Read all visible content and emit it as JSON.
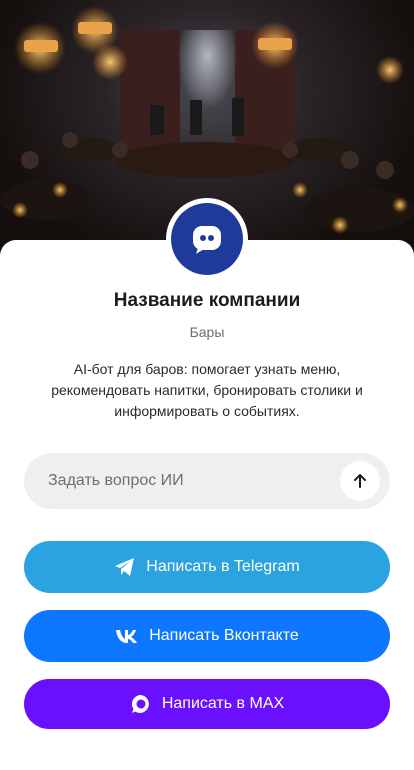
{
  "hero": {
    "image_alt": "bar-interior-photo"
  },
  "profile": {
    "avatar_icon": "chat-bot-icon",
    "company_name": "Название компании",
    "category": "Бары",
    "description": "AI-бот для баров: помогает узнать меню, рекомендовать напитки, бронировать столики и информировать о событиях."
  },
  "ask": {
    "placeholder": "Задать вопрос ИИ",
    "value": "",
    "send_icon": "arrow-up-icon"
  },
  "buttons": {
    "telegram": {
      "label": "Написать в Telegram",
      "icon": "telegram-icon",
      "color": "#2aa3e0"
    },
    "vk": {
      "label": "Написать Вконтакте",
      "icon": "vk-icon",
      "color": "#0d77ff"
    },
    "max": {
      "label": "Написать в MAX",
      "icon": "max-icon",
      "color": "#6a10ff"
    }
  },
  "colors": {
    "avatar_bg": "#1f3b9a",
    "input_bg": "#efefef"
  }
}
